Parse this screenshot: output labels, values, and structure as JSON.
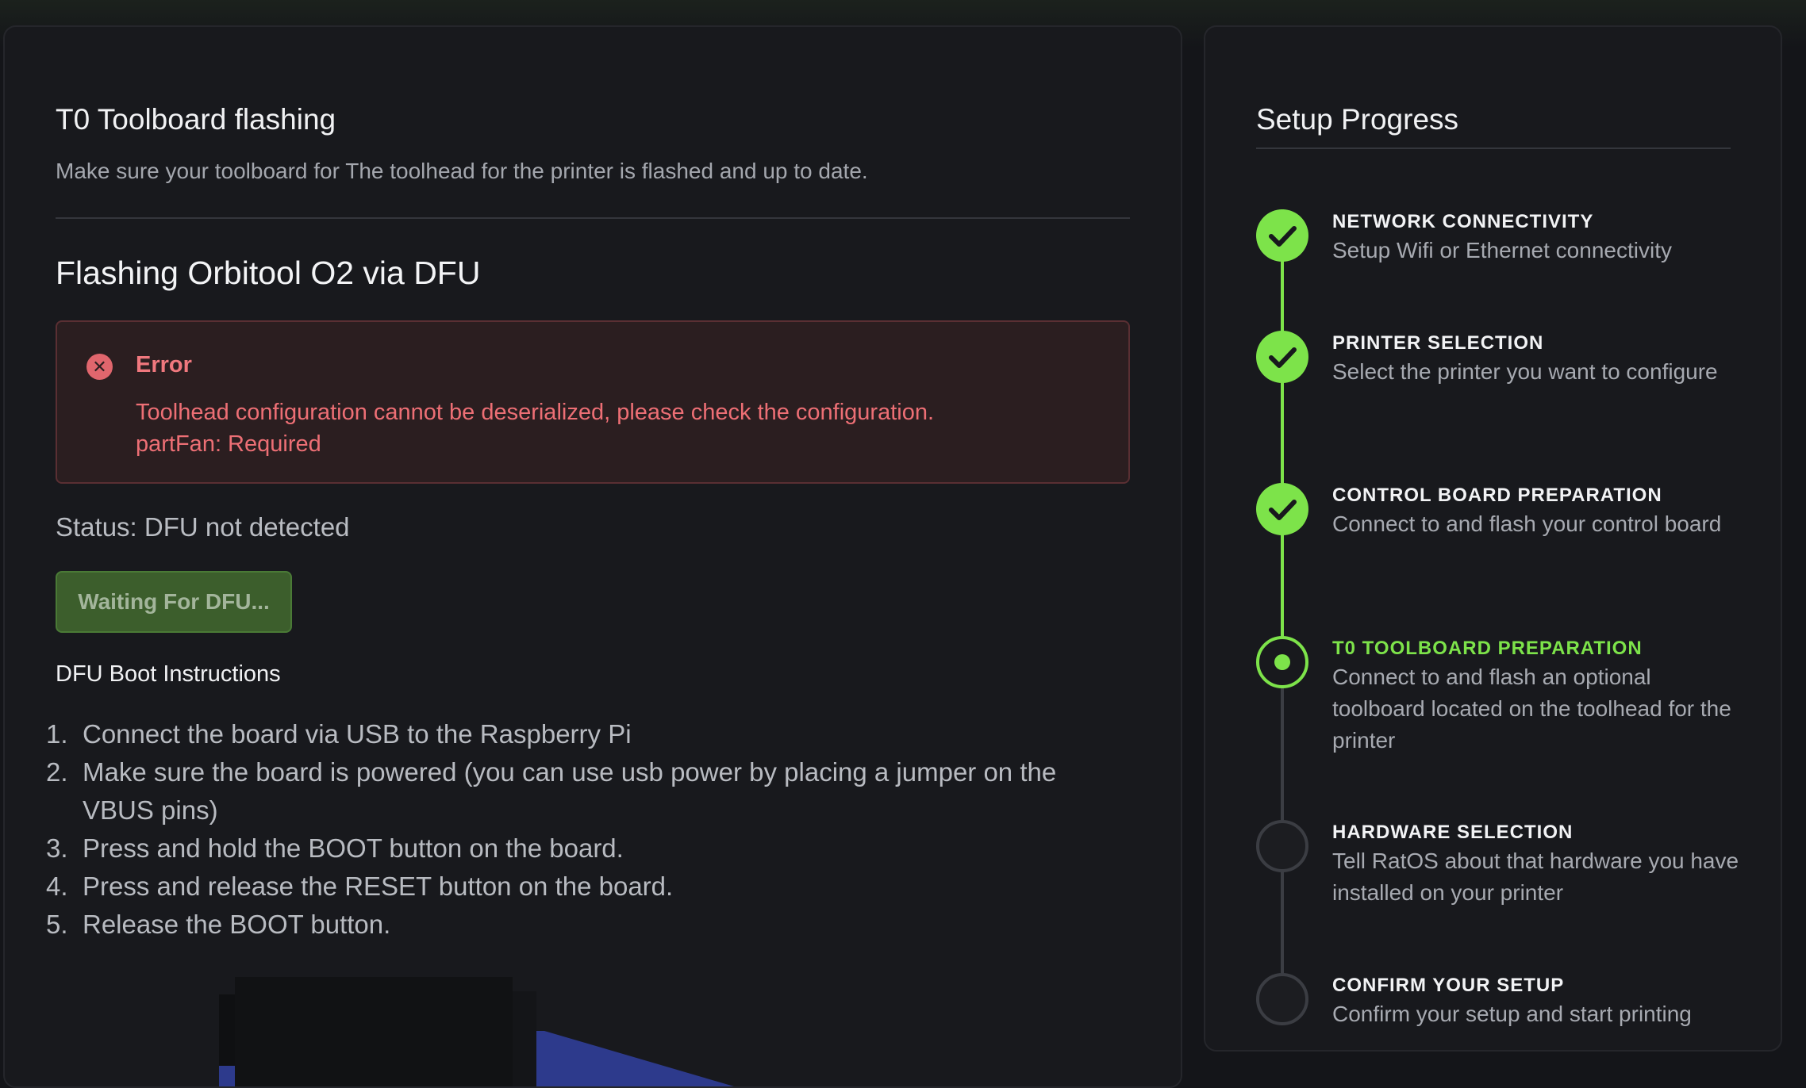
{
  "main": {
    "title": "T0 Toolboard flashing",
    "subtitle": "Make sure your toolboard for The toolhead for the printer is flashed and up to date.",
    "section_title": "Flashing Orbitool O2 via DFU",
    "error": {
      "title": "Error",
      "message_line1": "Toolhead configuration cannot be deserialized, please check the configuration.",
      "message_line2": "partFan: Required",
      "icon": "close-circle-icon",
      "color": "#ed6f75"
    },
    "status": "Status: DFU not detected",
    "wait_button_label": "Waiting For DFU...",
    "instructions_heading": "DFU Boot Instructions",
    "instructions": [
      {
        "num": "1.",
        "text": "Connect the board via USB to the Raspberry Pi"
      },
      {
        "num": "2.",
        "text": "Make sure the board is powered (you can use usb power by placing a jumper on the VBUS pins)"
      },
      {
        "num": "3.",
        "text": "Press and hold the BOOT button on the board."
      },
      {
        "num": "4.",
        "text": "Press and release the RESET button on the board."
      },
      {
        "num": "5.",
        "text": "Release the BOOT button."
      }
    ]
  },
  "progress": {
    "title": "Setup Progress",
    "accent_color": "#7de34a",
    "steps": [
      {
        "title": "NETWORK CONNECTIVITY",
        "desc": "Setup Wifi or Ethernet connectivity",
        "state": "done"
      },
      {
        "title": "PRINTER SELECTION",
        "desc": "Select the printer you want to configure",
        "state": "done"
      },
      {
        "title": "CONTROL BOARD PREPARATION",
        "desc": "Connect to and flash your control board",
        "state": "done"
      },
      {
        "title": "T0 TOOLBOARD PREPARATION",
        "desc": "Connect to and flash an optional toolboard located on the toolhead for the printer",
        "state": "current"
      },
      {
        "title": "HARDWARE SELECTION",
        "desc": "Tell RatOS about that hardware you have installed on your printer",
        "state": "pending"
      },
      {
        "title": "CONFIRM YOUR SETUP",
        "desc": "Confirm your setup and start printing",
        "state": "pending"
      }
    ]
  }
}
